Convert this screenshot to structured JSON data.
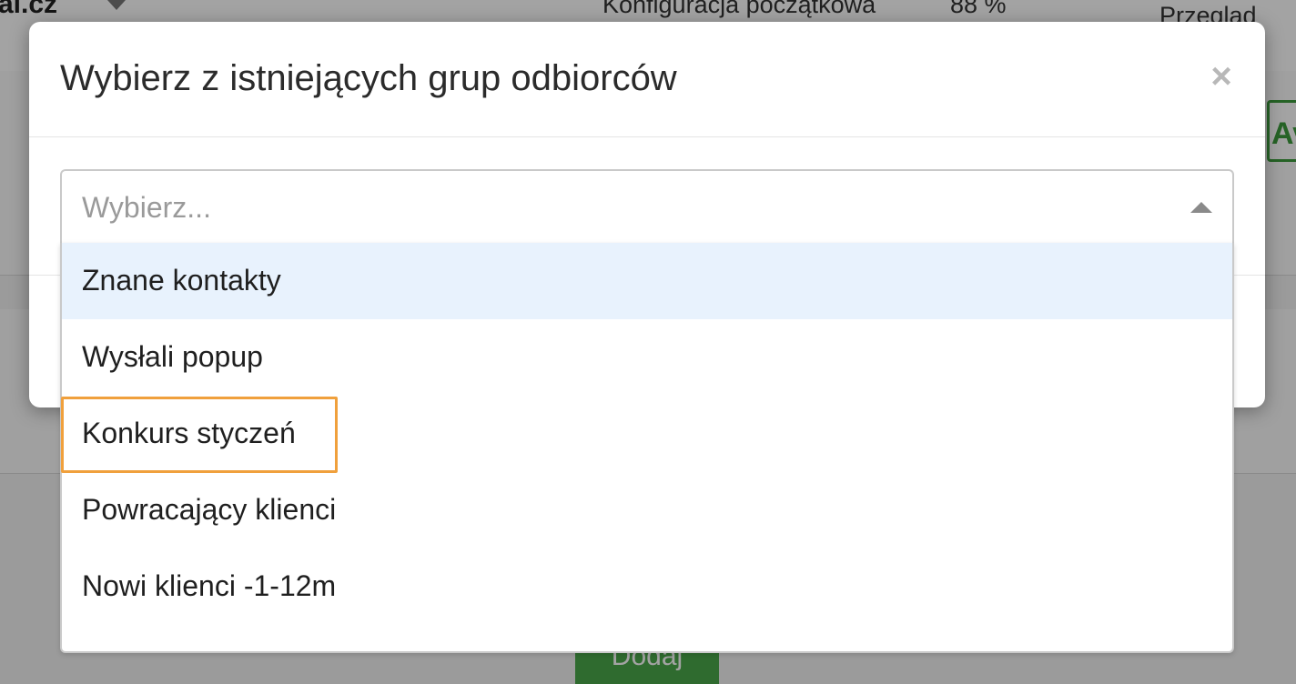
{
  "background": {
    "brand": "al.cz",
    "config_label": "Konfiguracja początkowa",
    "config_percent": "88 %",
    "review_label": "Przegląd",
    "green_button_label": "Avi",
    "add_button_label": "Dodaj"
  },
  "modal": {
    "title": "Wybierz z istniejących grup odbiorców",
    "close_glyph": "×"
  },
  "select": {
    "placeholder": "Wybierz...",
    "options": [
      {
        "label": "Znane kontakty",
        "highlighted": true
      },
      {
        "label": "Wysłali popup",
        "highlighted": false
      },
      {
        "label": "Konkurs styczeń",
        "highlighted": false,
        "focused": true
      },
      {
        "label": "Powracający klienci",
        "highlighted": false
      },
      {
        "label": "Nowi klienci -1-12m",
        "highlighted": false
      },
      {
        "label": "",
        "highlighted": false
      }
    ]
  },
  "colors": {
    "highlight": "#e8f2fd",
    "focus_ring": "#f0a03c",
    "accent_green": "#4aa84a"
  }
}
